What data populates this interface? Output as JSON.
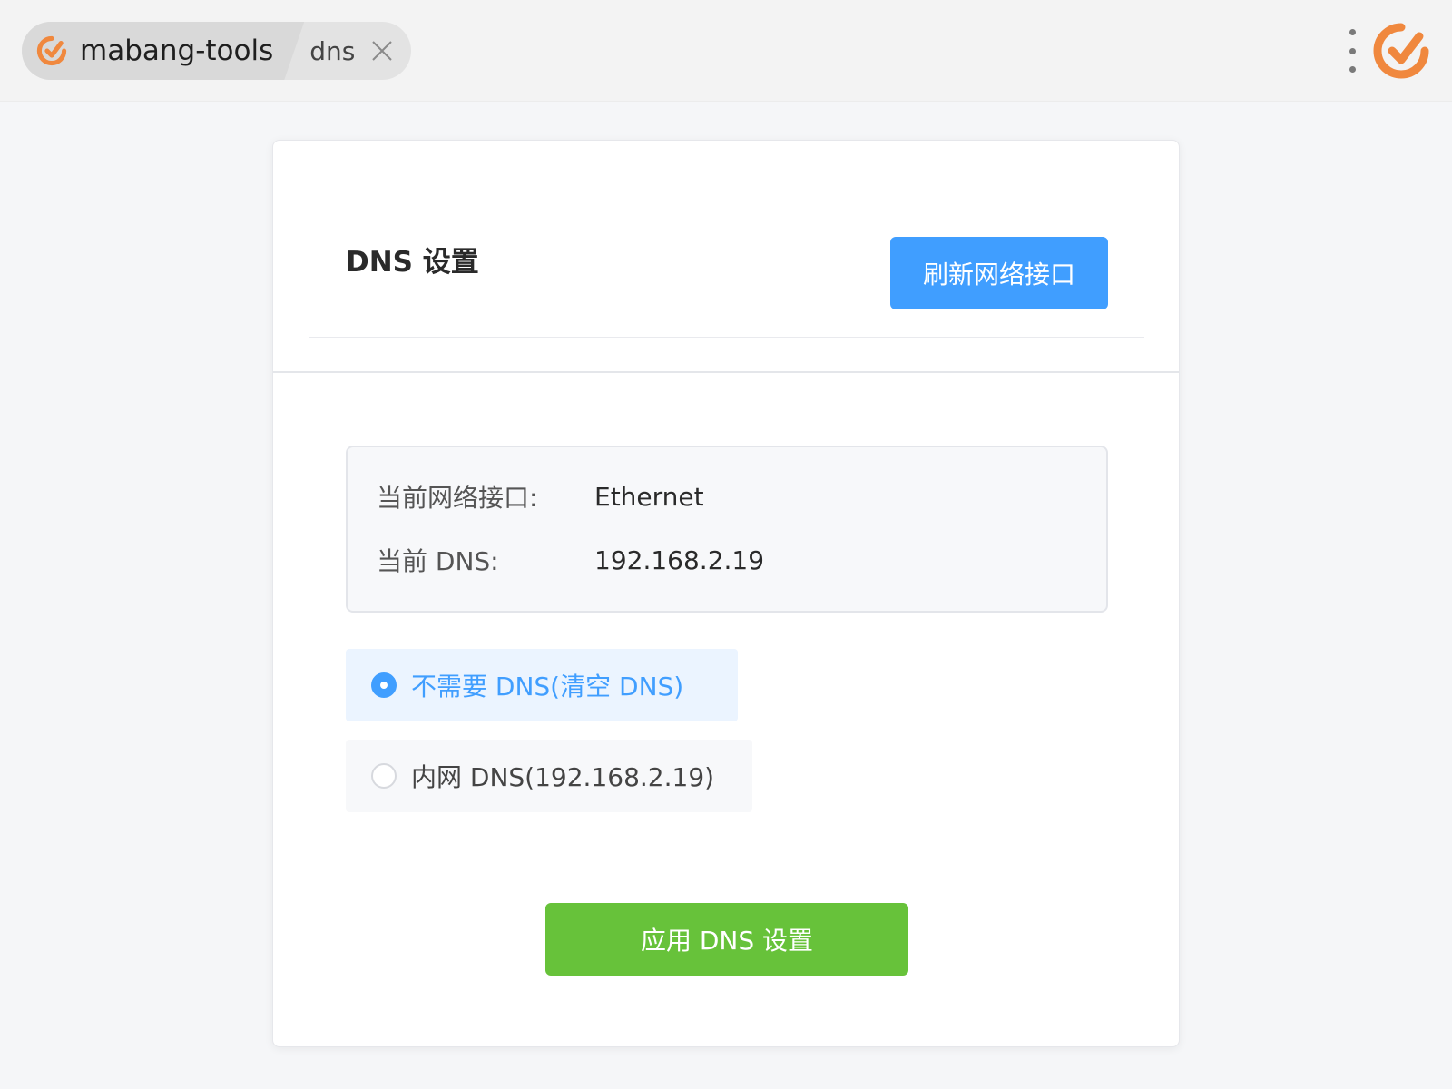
{
  "tabs": {
    "app_name": "mabang-tools",
    "page_name": "dns"
  },
  "colors": {
    "brand_orange": "#f0883e",
    "primary_blue": "#409eff",
    "success_green": "#67c23a"
  },
  "card": {
    "title": "DNS 设置",
    "refresh_button": "刷新网络接口"
  },
  "info": {
    "interface_label": "当前网络接口:",
    "interface_value": "Ethernet",
    "dns_label": "当前 DNS:",
    "dns_value": "192.168.2.19"
  },
  "options": [
    {
      "label": "不需要 DNS(清空 DNS)",
      "selected": true
    },
    {
      "label": "内网 DNS(192.168.2.19)",
      "selected": false
    }
  ],
  "apply_button": "应用 DNS 设置"
}
